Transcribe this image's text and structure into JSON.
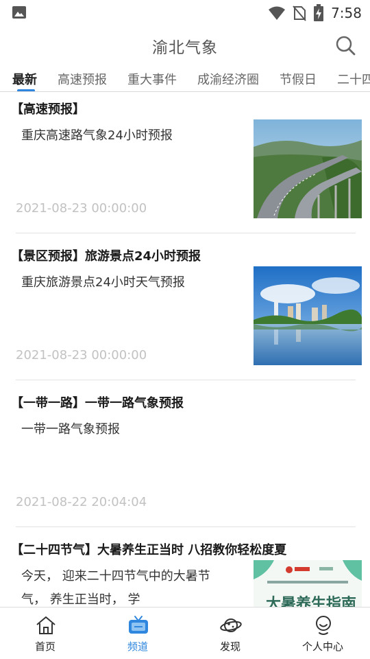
{
  "status_bar": {
    "time": "7:58",
    "icons": [
      "gallery-icon",
      "wifi-icon",
      "no-sim-icon",
      "battery-charging-icon"
    ]
  },
  "header": {
    "title": "渝北气象",
    "search_icon": "search-icon"
  },
  "tabs": [
    {
      "label": "最新",
      "active": true
    },
    {
      "label": "高速预报",
      "active": false
    },
    {
      "label": "重大事件",
      "active": false
    },
    {
      "label": "成渝经济圈",
      "active": false
    },
    {
      "label": "节假日",
      "active": false
    },
    {
      "label": "二十四",
      "active": false
    }
  ],
  "news": [
    {
      "title": "【高速预报】",
      "summary": "重庆高速路气象24小时预报",
      "date": "2021-08-23 00:00:00",
      "thumbnail": "highway-photo"
    },
    {
      "title": "【景区预报】旅游景点24小时预报",
      "summary": "重庆旅游景点24小时天气预报",
      "date": "2021-08-23 00:00:00",
      "thumbnail": "city-lake-photo"
    },
    {
      "title": "【一带一路】一带一路气象预报",
      "summary": "一带一路气象预报",
      "date": "2021-08-22 20:04:04",
      "thumbnail": null
    },
    {
      "title": "【二十四节气】大暑养生正当时 八招教你轻松度夏",
      "summary_lines": [
        "今天， 迎来二十四节气中的大暑节",
        "气， 养生正当时， 学"
      ],
      "thumbnail": "health-guide-poster",
      "thumbnail_text": "大暑养生指南"
    }
  ],
  "bottom_nav": [
    {
      "label": "首页",
      "icon": "home-icon",
      "active": false
    },
    {
      "label": "频道",
      "icon": "tv-channel-icon",
      "active": true
    },
    {
      "label": "发现",
      "icon": "planet-icon",
      "active": false
    },
    {
      "label": "个人中心",
      "icon": "user-icon",
      "active": false
    }
  ],
  "colors": {
    "accent": "#2e86de",
    "date_gray": "#c2c2c2",
    "divider": "#e2e2e2"
  }
}
